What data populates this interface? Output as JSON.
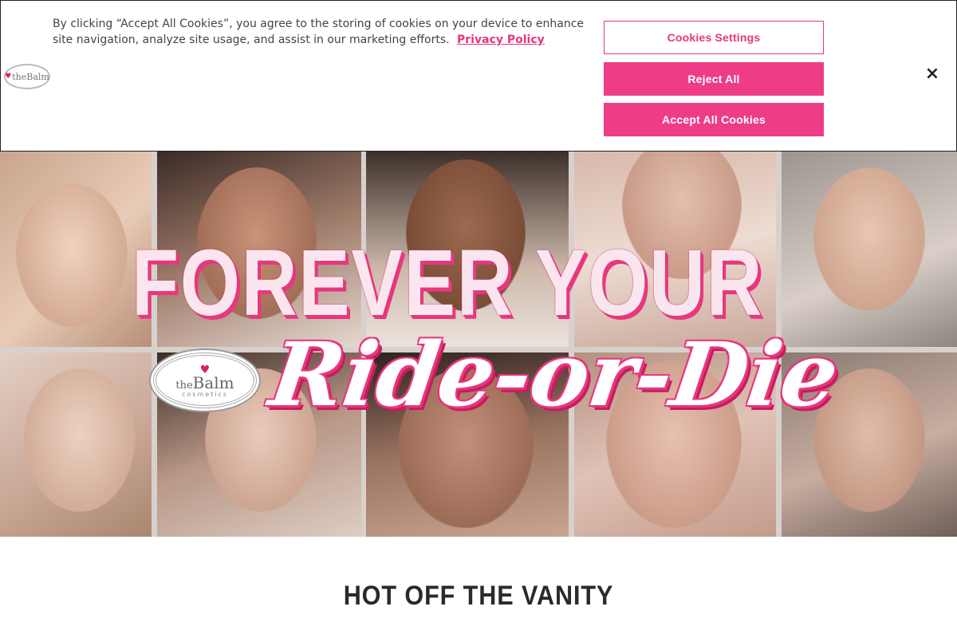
{
  "cookie_banner": {
    "text": "By clicking “Accept All Cookies”, you agree to the storing of cookies on your device to enhance site navigation, analyze site usage, and assist in our marketing efforts.",
    "privacy_link": "Privacy Policy",
    "logo_text": "theBalm",
    "settings_button": "Cookies Settings",
    "reject_button": "Reject All",
    "accept_button": "Accept All Cookies",
    "close_symbol": "×"
  },
  "hero": {
    "headline_line1": "FOREVER YOUR",
    "headline_line2": "Ride-or-Die",
    "logo": {
      "the": "the",
      "brand": "Balm",
      "sub": "cosmetics"
    },
    "accent_color": "#e8377d"
  },
  "section": {
    "title": "HOT OFF THE VANITY"
  },
  "colors": {
    "brand_pink": "#ee3d86",
    "text_dark": "#2a2a2a"
  }
}
